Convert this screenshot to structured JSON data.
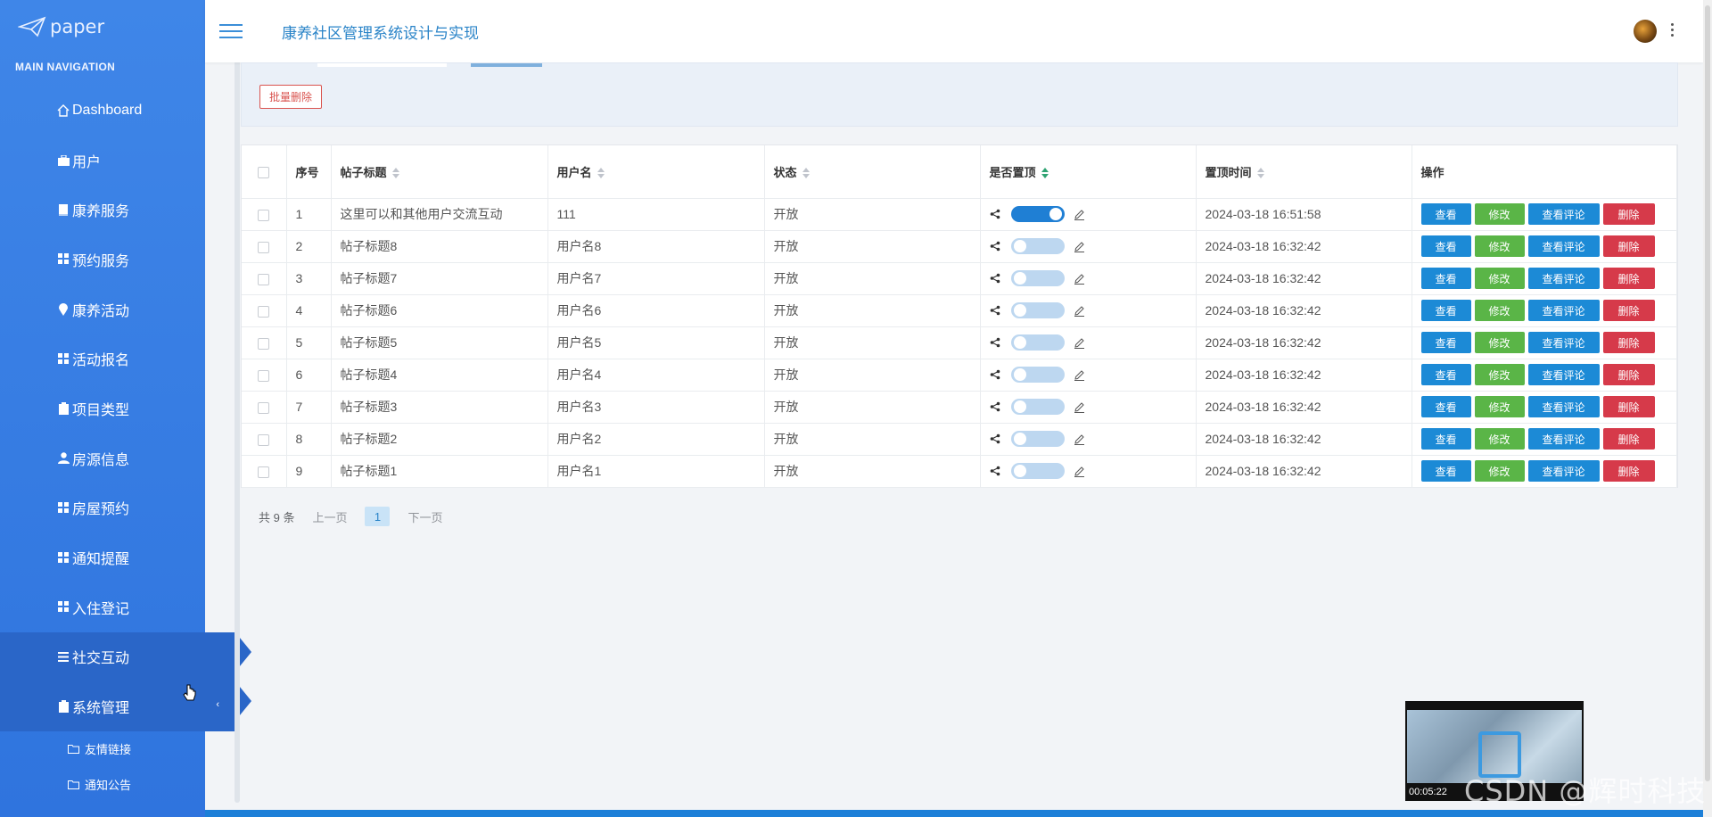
{
  "brand": {
    "name": "paper"
  },
  "sidebar": {
    "header": "MAIN NAVIGATION",
    "items": [
      {
        "label": "Dashboard",
        "icon": "home-icon"
      },
      {
        "label": "用户",
        "icon": "briefcase-icon"
      },
      {
        "label": "康养服务",
        "icon": "book-icon"
      },
      {
        "label": "预约服务",
        "icon": "grid-icon"
      },
      {
        "label": "康养活动",
        "icon": "map-pin-icon"
      },
      {
        "label": "活动报名",
        "icon": "grid-icon"
      },
      {
        "label": "项目类型",
        "icon": "clipboard-icon"
      },
      {
        "label": "房源信息",
        "icon": "user-icon"
      },
      {
        "label": "房屋预约",
        "icon": "grid-icon"
      },
      {
        "label": "通知提醒",
        "icon": "grid-icon"
      },
      {
        "label": "入住登记",
        "icon": "grid-icon"
      },
      {
        "label": "社交互动",
        "icon": "list-icon"
      },
      {
        "label": "系统管理",
        "icon": "clipboard-icon"
      }
    ],
    "sub_items": [
      {
        "label": "友情链接",
        "icon": "folder-icon"
      },
      {
        "label": "通知公告",
        "icon": "folder-icon"
      }
    ]
  },
  "header": {
    "title": "康养社区管理系统设计与实现"
  },
  "toolbar": {
    "batch_delete": "批量删除"
  },
  "table": {
    "headers": [
      "序号",
      "帖子标题",
      "用户名",
      "状态",
      "是否置顶",
      "置顶时间",
      "操作"
    ],
    "actions": {
      "view": "查看",
      "edit": "修改",
      "comments": "查看评论",
      "delete": "删除"
    },
    "rows": [
      {
        "no": "1",
        "title": "这里可以和其他用户交流互动",
        "user": "111",
        "status": "开放",
        "pinned": true,
        "time": "2024-03-18 16:51:58"
      },
      {
        "no": "2",
        "title": "帖子标题8",
        "user": "用户名8",
        "status": "开放",
        "pinned": false,
        "time": "2024-03-18 16:32:42"
      },
      {
        "no": "3",
        "title": "帖子标题7",
        "user": "用户名7",
        "status": "开放",
        "pinned": false,
        "time": "2024-03-18 16:32:42"
      },
      {
        "no": "4",
        "title": "帖子标题6",
        "user": "用户名6",
        "status": "开放",
        "pinned": false,
        "time": "2024-03-18 16:32:42"
      },
      {
        "no": "5",
        "title": "帖子标题5",
        "user": "用户名5",
        "status": "开放",
        "pinned": false,
        "time": "2024-03-18 16:32:42"
      },
      {
        "no": "6",
        "title": "帖子标题4",
        "user": "用户名4",
        "status": "开放",
        "pinned": false,
        "time": "2024-03-18 16:32:42"
      },
      {
        "no": "7",
        "title": "帖子标题3",
        "user": "用户名3",
        "status": "开放",
        "pinned": false,
        "time": "2024-03-18 16:32:42"
      },
      {
        "no": "8",
        "title": "帖子标题2",
        "user": "用户名2",
        "status": "开放",
        "pinned": false,
        "time": "2024-03-18 16:32:42"
      },
      {
        "no": "9",
        "title": "帖子标题1",
        "user": "用户名1",
        "status": "开放",
        "pinned": false,
        "time": "2024-03-18 16:32:42"
      }
    ]
  },
  "pagination": {
    "total": "共 9 条",
    "prev": "上一页",
    "current": "1",
    "next": "下一页"
  },
  "video": {
    "time": "00:05:22"
  },
  "watermark": "CSDN @辉时科技",
  "colors": {
    "sidebar": "#3a80e4",
    "accent": "#2a84c8",
    "view": "#1c8ad6",
    "edit": "#5ab547",
    "delete": "#d63a4a"
  }
}
